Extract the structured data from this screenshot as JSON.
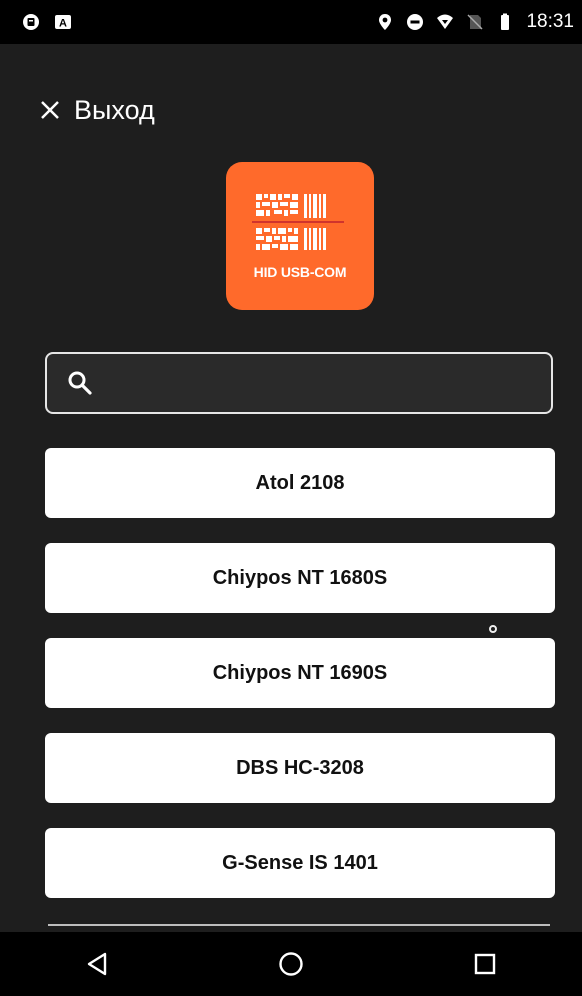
{
  "status_bar": {
    "time": "18:31",
    "left_icons": [
      "notification-app-icon",
      "notification-a-icon"
    ],
    "right_icons": [
      "location-icon",
      "do-not-disturb-icon",
      "wifi-icon",
      "no-sim-icon",
      "battery-icon"
    ]
  },
  "header": {
    "exit_label": "Выход",
    "exit_icon": "close-icon"
  },
  "logo": {
    "text": "HID USB-COM",
    "background": "#ff6a2b"
  },
  "search": {
    "value": "",
    "placeholder": ""
  },
  "devices": [
    {
      "label": "Atol 2108"
    },
    {
      "label": "Chiypos NT 1680S"
    },
    {
      "label": "Chiypos NT 1690S"
    },
    {
      "label": "DBS HC-3208"
    },
    {
      "label": "G-Sense IS 1401"
    }
  ],
  "nav_bar": {
    "icons": [
      "back-icon",
      "home-icon",
      "recents-icon"
    ]
  }
}
